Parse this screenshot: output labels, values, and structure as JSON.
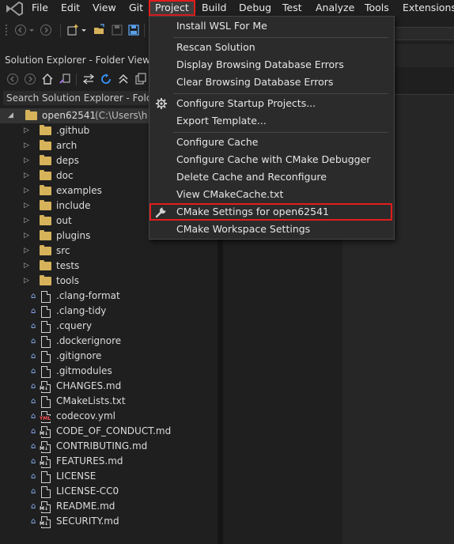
{
  "menubar": {
    "items": [
      "File",
      "Edit",
      "View",
      "Git",
      "Project",
      "Build",
      "Debug",
      "Test",
      "Analyze",
      "Tools",
      "Extensions"
    ]
  },
  "solution_explorer": {
    "title": "Solution Explorer - Folder View",
    "search_placeholder": "Search Solution Explorer - Folder",
    "root": {
      "name": "open62541",
      "path_hint": "(C:\\Users\\h"
    },
    "folders": [
      ".github",
      "arch",
      "deps",
      "doc",
      "examples",
      "include",
      "out",
      "plugins",
      "src",
      "tests",
      "tools"
    ],
    "files": [
      {
        "name": ".clang-format",
        "badge": ""
      },
      {
        "name": ".clang-tidy",
        "badge": ""
      },
      {
        "name": ".cquery",
        "badge": ""
      },
      {
        "name": ".dockerignore",
        "badge": ""
      },
      {
        "name": ".gitignore",
        "badge": ""
      },
      {
        "name": ".gitmodules",
        "badge": ""
      },
      {
        "name": "CHANGES.md",
        "badge": "M↓"
      },
      {
        "name": "CMakeLists.txt",
        "badge": ""
      },
      {
        "name": "codecov.yml",
        "badge": "YML"
      },
      {
        "name": "CODE_OF_CONDUCT.md",
        "badge": "M↓"
      },
      {
        "name": "CONTRIBUTING.md",
        "badge": "M↓"
      },
      {
        "name": "FEATURES.md",
        "badge": "M↓"
      },
      {
        "name": "LICENSE",
        "badge": ""
      },
      {
        "name": "LICENSE-CC0",
        "badge": ""
      },
      {
        "name": "README.md",
        "badge": "M↓"
      },
      {
        "name": "SECURITY.md",
        "badge": "M↓"
      }
    ]
  },
  "project_menu": {
    "items": [
      {
        "label": "Install WSL For Me"
      },
      {
        "label": "Rescan Solution"
      },
      {
        "label": "Display Browsing Database Errors"
      },
      {
        "label": "Clear Browsing Database Errors"
      },
      {
        "label": "Configure Startup Projects...",
        "icon": "gear-icon"
      },
      {
        "label": "Export Template..."
      },
      {
        "label": "Configure Cache"
      },
      {
        "label": "Configure Cache with CMake Debugger"
      },
      {
        "label": "Delete Cache and Reconfigure"
      },
      {
        "label": "View CMakeCache.txt"
      },
      {
        "label": "CMake Settings for open62541",
        "icon": "wrench-icon",
        "highlighted": true
      },
      {
        "label": "CMake Workspace Settings"
      }
    ]
  },
  "colors": {
    "highlight_outline": "#e31c1c",
    "folder": "#d6b25a",
    "accent_blue": "#3794ff"
  }
}
